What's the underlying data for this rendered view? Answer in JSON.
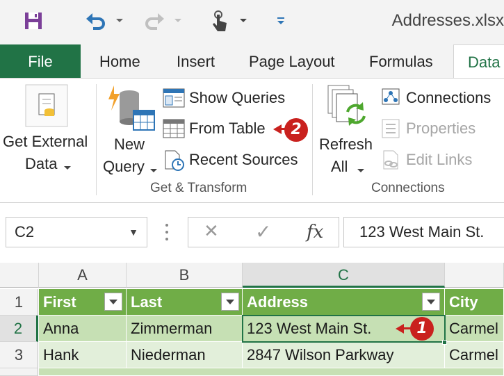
{
  "title_bar": {
    "document_title": "Addresses.xlsx",
    "icons": [
      "save-icon",
      "undo-icon",
      "redo-icon",
      "touch-mode-icon",
      "customize-qat-icon"
    ]
  },
  "tabs": {
    "file": "File",
    "home": "Home",
    "insert": "Insert",
    "page_layout": "Page Layout",
    "formulas": "Formulas",
    "data": "Data",
    "active": "Data"
  },
  "ribbon": {
    "get_external_data": {
      "line1": "Get External",
      "line2": "Data"
    },
    "new_query": {
      "line1": "New",
      "line2": "Query"
    },
    "show_queries": "Show Queries",
    "from_table": "From Table",
    "recent_sources": "Recent Sources",
    "group_get_transform": "Get & Transform",
    "refresh_all": {
      "line1": "Refresh",
      "line2": "All"
    },
    "connections": "Connections",
    "properties": "Properties",
    "edit_links": "Edit Links",
    "group_connections": "Connections"
  },
  "callouts": {
    "one": "1",
    "two": "2"
  },
  "formula_bar": {
    "name_box": "C2",
    "cancel_symbol": "✕",
    "enter_symbol": "✓",
    "fx_label": "fx",
    "value": "123 West Main St."
  },
  "grid": {
    "columns": [
      "A",
      "B",
      "C"
    ],
    "rows": [
      "1",
      "2",
      "3"
    ],
    "selected_cell": "C2",
    "header": [
      "First",
      "Last",
      "Address",
      "City"
    ],
    "data": [
      [
        "Anna",
        "Zimmerman",
        "123 West Main St.",
        "Carmel"
      ],
      [
        "Hank",
        "Niederman",
        "2847 Wilson Parkway",
        "Carmel"
      ]
    ]
  },
  "colors": {
    "accent": "#217346",
    "table_header": "#70ad47",
    "row_band_dark": "#c6e0b4",
    "row_band_light": "#e2efda",
    "callout": "#c9211e"
  }
}
